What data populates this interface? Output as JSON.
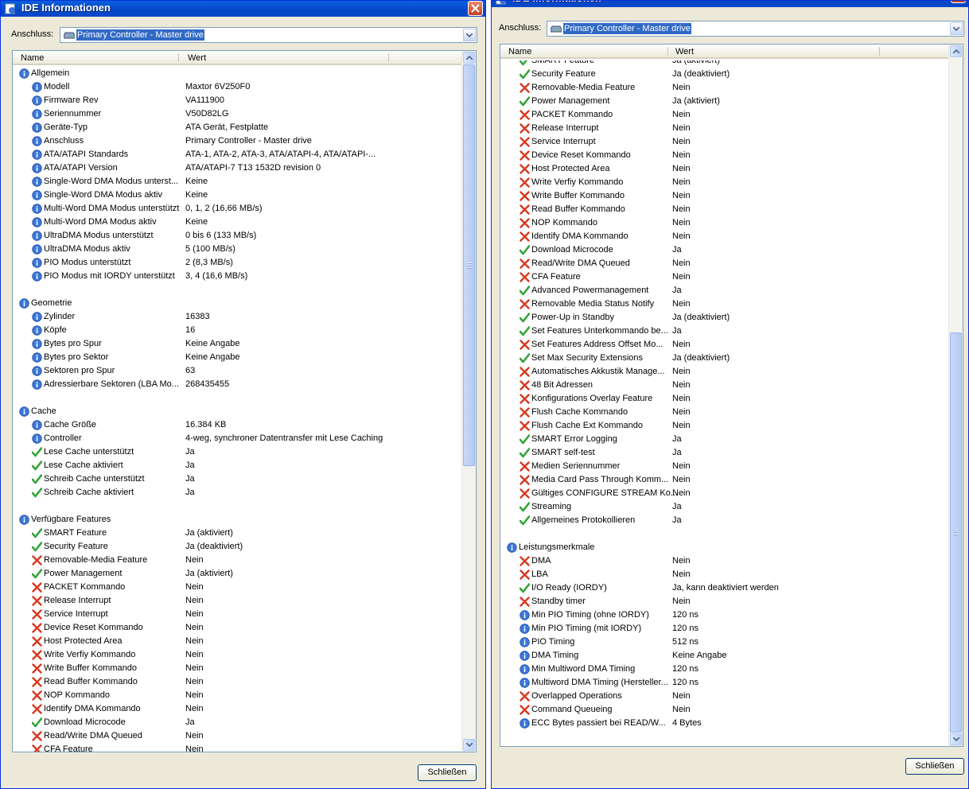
{
  "window_title": "IDE Informationen",
  "anschluss_label": "Anschluss:",
  "anschluss_value": "Primary Controller - Master drive",
  "columns": {
    "name": "Name",
    "value": "Wert"
  },
  "close_button": "Schließen",
  "left_rows": [
    {
      "icon": "info",
      "name": "Allgemein",
      "value": "",
      "group": true
    },
    {
      "icon": "info",
      "name": "Modell",
      "value": "Maxtor 6V250F0"
    },
    {
      "icon": "info",
      "name": "Firmware Rev",
      "value": "VA111900"
    },
    {
      "icon": "info",
      "name": "Seriennummer",
      "value": "V50D82LG"
    },
    {
      "icon": "info",
      "name": "Geräte-Typ",
      "value": "ATA Gerät, Festplatte"
    },
    {
      "icon": "info",
      "name": "Anschluss",
      "value": "Primary Controller - Master drive"
    },
    {
      "icon": "info",
      "name": "ATA/ATAPI Standards",
      "value": "ATA-1, ATA-2, ATA-3, ATA/ATAPI-4, ATA/ATAPI-..."
    },
    {
      "icon": "info",
      "name": "ATA/ATAPI Version",
      "value": "ATA/ATAPI-7 T13 1532D revision 0"
    },
    {
      "icon": "info",
      "name": "Single-Word DMA Modus unterst...",
      "value": "Keine"
    },
    {
      "icon": "info",
      "name": "Single-Word DMA Modus aktiv",
      "value": "Keine"
    },
    {
      "icon": "info",
      "name": "Multi-Word DMA Modus unterstützt",
      "value": "0, 1, 2 (16,66 MB/s)"
    },
    {
      "icon": "info",
      "name": "Multi-Word DMA Modus aktiv",
      "value": "Keine"
    },
    {
      "icon": "info",
      "name": "UltraDMA Modus unterstützt",
      "value": "0 bis 6 (133 MB/s)"
    },
    {
      "icon": "info",
      "name": "UltraDMA Modus aktiv",
      "value": "5 (100 MB/s)"
    },
    {
      "icon": "info",
      "name": "PIO Modus unterstützt",
      "value": "2 (8,3 MB/s)"
    },
    {
      "icon": "info",
      "name": "PIO Modus mit IORDY unterstützt",
      "value": "3, 4 (16,6 MB/s)"
    },
    {
      "icon": "none",
      "name": "",
      "value": ""
    },
    {
      "icon": "info",
      "name": "Geometrie",
      "value": "",
      "group": true
    },
    {
      "icon": "info",
      "name": "Zylinder",
      "value": "16383"
    },
    {
      "icon": "info",
      "name": "Köpfe",
      "value": "16"
    },
    {
      "icon": "info",
      "name": "Bytes pro Spur",
      "value": "Keine Angabe"
    },
    {
      "icon": "info",
      "name": "Bytes pro Sektor",
      "value": "Keine Angabe"
    },
    {
      "icon": "info",
      "name": "Sektoren pro Spur",
      "value": "63"
    },
    {
      "icon": "info",
      "name": "Adressierbare Sektoren (LBA Mo...",
      "value": "268435455"
    },
    {
      "icon": "none",
      "name": "",
      "value": ""
    },
    {
      "icon": "info",
      "name": "Cache",
      "value": "",
      "group": true
    },
    {
      "icon": "info",
      "name": "Cache Größe",
      "value": "16.384 KB"
    },
    {
      "icon": "info",
      "name": "Controller",
      "value": "4-weg, synchroner Datentransfer mit Lese Caching"
    },
    {
      "icon": "check",
      "name": "Lese Cache unterstützt",
      "value": "Ja"
    },
    {
      "icon": "check",
      "name": "Lese Cache aktiviert",
      "value": "Ja"
    },
    {
      "icon": "check",
      "name": "Schreib Cache unterstützt",
      "value": "Ja"
    },
    {
      "icon": "check",
      "name": "Schreib Cache aktiviert",
      "value": "Ja"
    },
    {
      "icon": "none",
      "name": "",
      "value": ""
    },
    {
      "icon": "info",
      "name": "Verfügbare Features",
      "value": "",
      "group": true
    },
    {
      "icon": "check",
      "name": "SMART Feature",
      "value": "Ja (aktiviert)"
    },
    {
      "icon": "check",
      "name": "Security Feature",
      "value": "Ja (deaktiviert)"
    },
    {
      "icon": "cross",
      "name": "Removable-Media Feature",
      "value": "Nein"
    },
    {
      "icon": "check",
      "name": "Power Management",
      "value": "Ja (aktiviert)"
    },
    {
      "icon": "cross",
      "name": "PACKET Kommando",
      "value": "Nein"
    },
    {
      "icon": "cross",
      "name": "Release Interrupt",
      "value": "Nein"
    },
    {
      "icon": "cross",
      "name": "Service Interrupt",
      "value": "Nein"
    },
    {
      "icon": "cross",
      "name": "Device Reset Kommando",
      "value": "Nein"
    },
    {
      "icon": "cross",
      "name": "Host Protected Area",
      "value": "Nein"
    },
    {
      "icon": "cross",
      "name": "Write Verfiy Kommando",
      "value": "Nein"
    },
    {
      "icon": "cross",
      "name": "Write Buffer Kommando",
      "value": "Nein"
    },
    {
      "icon": "cross",
      "name": "Read Buffer Kommando",
      "value": "Nein"
    },
    {
      "icon": "cross",
      "name": "NOP Kommando",
      "value": "Nein"
    },
    {
      "icon": "cross",
      "name": "Identify DMA Kommando",
      "value": "Nein"
    },
    {
      "icon": "check",
      "name": "Download Microcode",
      "value": "Ja"
    },
    {
      "icon": "cross",
      "name": "Read/Write DMA Queued",
      "value": "Nein"
    },
    {
      "icon": "cross",
      "name": "CFA Feature",
      "value": "Nein"
    }
  ],
  "right_rows": [
    {
      "icon": "check",
      "name": "SMART Feature",
      "value": "Ja (aktiviert)"
    },
    {
      "icon": "check",
      "name": "Security Feature",
      "value": "Ja (deaktiviert)"
    },
    {
      "icon": "cross",
      "name": "Removable-Media Feature",
      "value": "Nein"
    },
    {
      "icon": "check",
      "name": "Power Management",
      "value": "Ja (aktiviert)"
    },
    {
      "icon": "cross",
      "name": "PACKET Kommando",
      "value": "Nein"
    },
    {
      "icon": "cross",
      "name": "Release Interrupt",
      "value": "Nein"
    },
    {
      "icon": "cross",
      "name": "Service Interrupt",
      "value": "Nein"
    },
    {
      "icon": "cross",
      "name": "Device Reset Kommando",
      "value": "Nein"
    },
    {
      "icon": "cross",
      "name": "Host Protected Area",
      "value": "Nein"
    },
    {
      "icon": "cross",
      "name": "Write Verfiy Kommando",
      "value": "Nein"
    },
    {
      "icon": "cross",
      "name": "Write Buffer Kommando",
      "value": "Nein"
    },
    {
      "icon": "cross",
      "name": "Read Buffer Kommando",
      "value": "Nein"
    },
    {
      "icon": "cross",
      "name": "NOP Kommando",
      "value": "Nein"
    },
    {
      "icon": "cross",
      "name": "Identify DMA Kommando",
      "value": "Nein"
    },
    {
      "icon": "check",
      "name": "Download Microcode",
      "value": "Ja"
    },
    {
      "icon": "cross",
      "name": "Read/Write DMA Queued",
      "value": "Nein"
    },
    {
      "icon": "cross",
      "name": "CFA Feature",
      "value": "Nein"
    },
    {
      "icon": "check",
      "name": "Advanced Powermanagement",
      "value": "Ja"
    },
    {
      "icon": "cross",
      "name": "Removable Media Status Notify",
      "value": "Nein"
    },
    {
      "icon": "check",
      "name": "Power-Up in Standby",
      "value": "Ja (deaktiviert)"
    },
    {
      "icon": "check",
      "name": "Set Features Unterkommando be...",
      "value": "Ja"
    },
    {
      "icon": "cross",
      "name": "Set Features Address Offset Mo...",
      "value": "Nein"
    },
    {
      "icon": "check",
      "name": "Set Max Security Extensions",
      "value": "Ja (deaktiviert)"
    },
    {
      "icon": "cross",
      "name": "Automatisches Akkustik Manage...",
      "value": "Nein"
    },
    {
      "icon": "cross",
      "name": "48 Bit Adressen",
      "value": "Nein"
    },
    {
      "icon": "cross",
      "name": "Konfigurations Overlay Feature",
      "value": "Nein"
    },
    {
      "icon": "cross",
      "name": "Flush Cache Kommando",
      "value": "Nein"
    },
    {
      "icon": "cross",
      "name": "Flush Cache Ext Kommando",
      "value": "Nein"
    },
    {
      "icon": "check",
      "name": "SMART Error Logging",
      "value": "Ja"
    },
    {
      "icon": "check",
      "name": "SMART self-test",
      "value": "Ja"
    },
    {
      "icon": "cross",
      "name": "Medien Seriennummer",
      "value": "Nein"
    },
    {
      "icon": "cross",
      "name": "Media Card Pass Through Komm...",
      "value": "Nein"
    },
    {
      "icon": "cross",
      "name": "Gültiges CONFIGURE STREAM Ko...",
      "value": "Nein"
    },
    {
      "icon": "check",
      "name": "Streaming",
      "value": "Ja"
    },
    {
      "icon": "check",
      "name": "Allgemeines Protokollieren",
      "value": "Ja"
    },
    {
      "icon": "none",
      "name": "",
      "value": ""
    },
    {
      "icon": "info",
      "name": "Leistungsmerkmale",
      "value": "",
      "group": true
    },
    {
      "icon": "cross",
      "name": "DMA",
      "value": "Nein"
    },
    {
      "icon": "cross",
      "name": "LBA",
      "value": "Nein"
    },
    {
      "icon": "check",
      "name": "I/O Ready (IORDY)",
      "value": "Ja, kann deaktiviert werden"
    },
    {
      "icon": "cross",
      "name": "Standby timer",
      "value": "Nein"
    },
    {
      "icon": "info",
      "name": "Min PIO Timing (ohne IORDY)",
      "value": "120 ns"
    },
    {
      "icon": "info",
      "name": "Min PIO Timing (mit IORDY)",
      "value": "120 ns"
    },
    {
      "icon": "info",
      "name": "PIO Timing",
      "value": "512 ns"
    },
    {
      "icon": "info",
      "name": "DMA Timing",
      "value": "Keine Angabe"
    },
    {
      "icon": "info",
      "name": "Min Multiword DMA Timing",
      "value": "120 ns"
    },
    {
      "icon": "info",
      "name": "Multiword DMA Timing (Hersteller...",
      "value": "120 ns"
    },
    {
      "icon": "cross",
      "name": "Overlapped Operations",
      "value": "Nein"
    },
    {
      "icon": "cross",
      "name": "Command Queueing",
      "value": "Nein"
    },
    {
      "icon": "info",
      "name": "ECC Bytes passiert bei READ/W...",
      "value": "4 Bytes"
    }
  ]
}
